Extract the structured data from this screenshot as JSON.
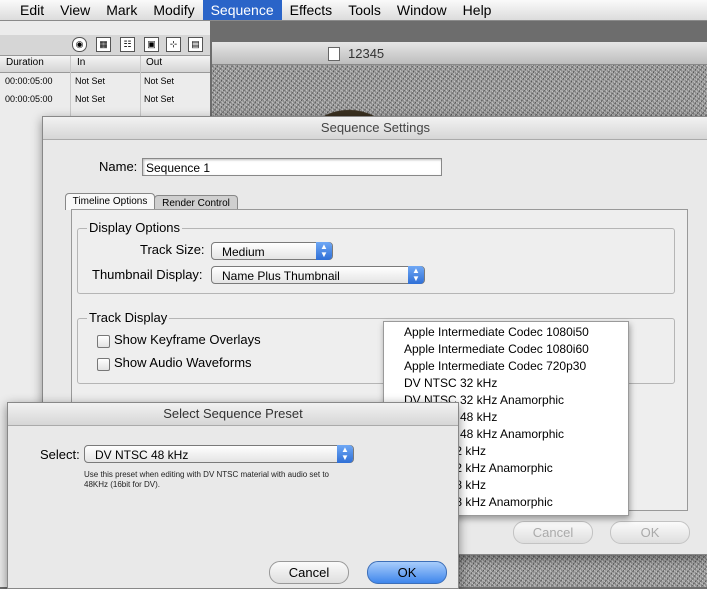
{
  "menubar": {
    "items": [
      "Edit",
      "View",
      "Mark",
      "Modify",
      "Sequence",
      "Effects",
      "Tools",
      "Window",
      "Help"
    ],
    "active": "Sequence"
  },
  "browser": {
    "headers": [
      "Duration",
      "In",
      "Out"
    ],
    "rows": [
      [
        "00:00:05:00",
        "Not Set",
        "Not Set"
      ],
      [
        "00:00:05:00",
        "Not Set",
        "Not Set"
      ]
    ]
  },
  "viewer": {
    "title": "12345"
  },
  "sequence_settings": {
    "title": "Sequence Settings",
    "name_label": "Name:",
    "name_value": "Sequence 1",
    "tabs": [
      "Timeline Options",
      "Render Control"
    ],
    "display_options": {
      "title": "Display Options",
      "track_size_label": "Track Size:",
      "track_size_value": "Medium",
      "thumbnail_label": "Thumbnail Display:",
      "thumbnail_value": "Name Plus Thumbnail"
    },
    "track_display": {
      "title": "Track Display",
      "keyframe_label": "Show Keyframe Overlays",
      "waveforms_label": "Show Audio Waveforms"
    },
    "cancel_label": "Cancel",
    "ok_label": "OK"
  },
  "dropdown_options": [
    "Apple Intermediate Codec 1080i50",
    "Apple Intermediate Codec 1080i60",
    "Apple Intermediate Codec 720p30",
    "DV NTSC 32 kHz",
    "DV NTSC 32 kHz Anamorphic",
    "DV NTSC 48 kHz",
    "DV NTSC 48 kHz Anamorphic",
    "DV PAL 32 kHz",
    "DV PAL 32 kHz Anamorphic",
    "DV PAL 48 kHz",
    "DV PAL 48 kHz Anamorphic"
  ],
  "preset_dialog": {
    "title": "Select Sequence Preset",
    "select_label": "Select:",
    "select_value": "DV NTSC 48 kHz",
    "description_line1": "Use this preset when editing with DV NTSC material with audio set to",
    "description_line2": "48KHz (16bit for DV).",
    "cancel_label": "Cancel",
    "ok_label": "OK"
  }
}
